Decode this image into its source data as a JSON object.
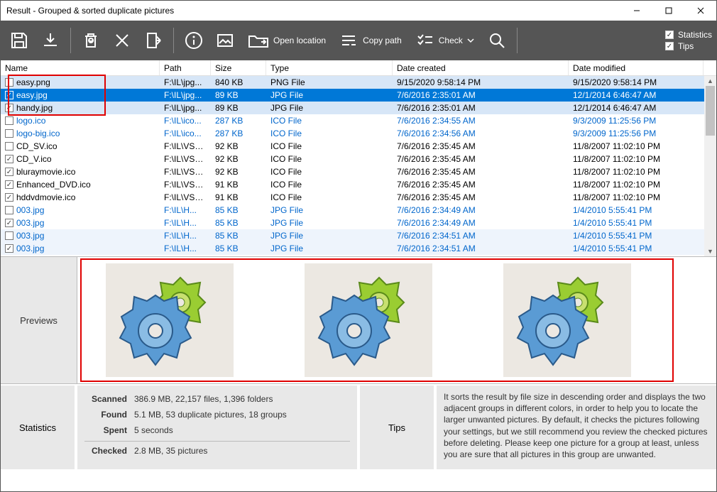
{
  "window": {
    "title": "Result - Grouped & sorted duplicate pictures"
  },
  "toolbar": {
    "open_location": "Open location",
    "copy_path": "Copy path",
    "check": "Check",
    "statistics_cb": "Statistics",
    "tips_cb": "Tips"
  },
  "columns": {
    "name": "Name",
    "path": "Path",
    "size": "Size",
    "type": "Type",
    "created": "Date created",
    "modified": "Date modified"
  },
  "rows": [
    {
      "checked": false,
      "name": "easy.png",
      "path": "F:\\IL\\jpg...",
      "size": "840 KB",
      "type": "PNG File",
      "created": "9/15/2020 9:58:14 PM",
      "modified": "9/15/2020 9:58:14 PM",
      "style": "shade"
    },
    {
      "checked": true,
      "name": "easy.jpg",
      "path": "F:\\IL\\jpg...",
      "size": "89 KB",
      "type": "JPG File",
      "created": "7/6/2016 2:35:01 AM",
      "modified": "12/1/2014 6:46:47 AM",
      "style": "sel"
    },
    {
      "checked": true,
      "name": "handy.jpg",
      "path": "F:\\IL\\jpg...",
      "size": "89 KB",
      "type": "JPG File",
      "created": "7/6/2016 2:35:01 AM",
      "modified": "12/1/2014 6:46:47 AM",
      "style": "shade"
    },
    {
      "checked": false,
      "name": "logo.ico",
      "path": "F:\\IL\\ico...",
      "size": "287 KB",
      "type": "ICO File",
      "created": "7/6/2016 2:34:55 AM",
      "modified": "9/3/2009 11:25:56 PM",
      "style": "blue"
    },
    {
      "checked": false,
      "name": "logo-big.ico",
      "path": "F:\\IL\\ico...",
      "size": "287 KB",
      "type": "ICO File",
      "created": "7/6/2016 2:34:56 AM",
      "modified": "9/3/2009 11:25:56 PM",
      "style": "blue"
    },
    {
      "checked": false,
      "name": "CD_SV.ico",
      "path": "F:\\IL\\VS2...",
      "size": "92 KB",
      "type": "ICO File",
      "created": "7/6/2016 2:35:45 AM",
      "modified": "11/8/2007 11:02:10 PM",
      "style": "plain"
    },
    {
      "checked": true,
      "name": "CD_V.ico",
      "path": "F:\\IL\\VS2...",
      "size": "92 KB",
      "type": "ICO File",
      "created": "7/6/2016 2:35:45 AM",
      "modified": "11/8/2007 11:02:10 PM",
      "style": "plain"
    },
    {
      "checked": true,
      "name": "bluraymovie.ico",
      "path": "F:\\IL\\VS2...",
      "size": "92 KB",
      "type": "ICO File",
      "created": "7/6/2016 2:35:45 AM",
      "modified": "11/8/2007 11:02:10 PM",
      "style": "plain"
    },
    {
      "checked": true,
      "name": "Enhanced_DVD.ico",
      "path": "F:\\IL\\VS2...",
      "size": "91 KB",
      "type": "ICO File",
      "created": "7/6/2016 2:35:45 AM",
      "modified": "11/8/2007 11:02:10 PM",
      "style": "plain"
    },
    {
      "checked": true,
      "name": "hddvdmovie.ico",
      "path": "F:\\IL\\VS2...",
      "size": "91 KB",
      "type": "ICO File",
      "created": "7/6/2016 2:35:45 AM",
      "modified": "11/8/2007 11:02:10 PM",
      "style": "plain"
    },
    {
      "checked": false,
      "name": "003.jpg",
      "path": "F:\\IL\\H...",
      "size": "85 KB",
      "type": "JPG File",
      "created": "7/6/2016 2:34:49 AM",
      "modified": "1/4/2010 5:55:41 PM",
      "style": "blue"
    },
    {
      "checked": true,
      "name": "003.jpg",
      "path": "F:\\IL\\H...",
      "size": "85 KB",
      "type": "JPG File",
      "created": "7/6/2016 2:34:49 AM",
      "modified": "1/4/2010 5:55:41 PM",
      "style": "blue"
    },
    {
      "checked": false,
      "name": "003.jpg",
      "path": "F:\\IL\\H...",
      "size": "85 KB",
      "type": "JPG File",
      "created": "7/6/2016 2:34:51 AM",
      "modified": "1/4/2010 5:55:41 PM",
      "style": "blue2"
    },
    {
      "checked": true,
      "name": "003.jpg",
      "path": "F:\\IL\\H...",
      "size": "85 KB",
      "type": "JPG File",
      "created": "7/6/2016 2:34:51 AM",
      "modified": "1/4/2010 5:55:41 PM",
      "style": "blue2"
    }
  ],
  "previews_label": "Previews",
  "stats": {
    "title": "Statistics",
    "scanned_l": "Scanned",
    "scanned_v": "386.9 MB, 22,157 files, 1,396 folders",
    "found_l": "Found",
    "found_v": "5.1 MB, 53 duplicate pictures, 18 groups",
    "spent_l": "Spent",
    "spent_v": "5 seconds",
    "checked_l": "Checked",
    "checked_v": "2.8 MB, 35 pictures"
  },
  "tips": {
    "title": "Tips",
    "body": "It sorts the result by file size in descending order and displays the two adjacent groups in different colors, in order to help you to locate the larger unwanted pictures. By default, it checks the pictures following your settings, but we still recommend you review the checked pictures before deleting. Please keep one picture for a group at least, unless you are sure that all pictures in this group are unwanted."
  }
}
